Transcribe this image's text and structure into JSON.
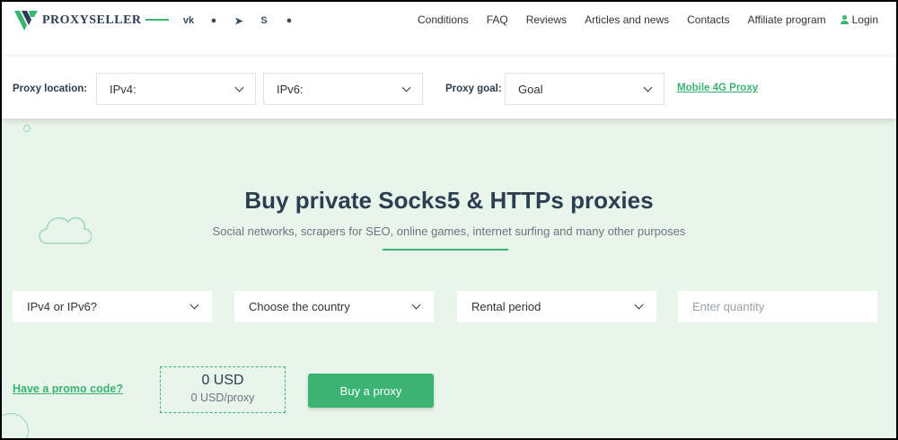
{
  "brand": {
    "name": "PROXYSELLER",
    "accent": "#3bb371",
    "dark": "#2c3e50"
  },
  "social": [
    {
      "icon": "vk-icon",
      "glyph": "vk"
    },
    {
      "icon": "messenger-icon",
      "glyph": "●"
    },
    {
      "icon": "telegram-icon",
      "glyph": "➤"
    },
    {
      "icon": "skype-icon",
      "glyph": "S"
    },
    {
      "icon": "chat-icon",
      "glyph": "●"
    }
  ],
  "nav": {
    "items": [
      "Conditions",
      "FAQ",
      "Reviews",
      "Articles and news",
      "Contacts",
      "Affiliate program"
    ],
    "login": "Login"
  },
  "filters": {
    "location_label": "Proxy location:",
    "ipv4": "IPv4:",
    "ipv6": "IPv6:",
    "goal_label": "Proxy goal:",
    "goal": "Goal",
    "mobile_link": "Mobile 4G Proxy"
  },
  "hero": {
    "title": "Buy private Socks5 & HTTPs proxies",
    "subtitle": "Social networks, scrapers for SEO, online games, internet surfing and many other purposes"
  },
  "order": {
    "ip_version": "IPv4 or IPv6?",
    "country": "Choose the country",
    "period": "Rental period",
    "quantity_placeholder": "Enter quantity",
    "promo": "Have a promo code?",
    "price": "0 USD",
    "price_per": "0 USD/proxy",
    "buy": "Buy a proxy"
  }
}
